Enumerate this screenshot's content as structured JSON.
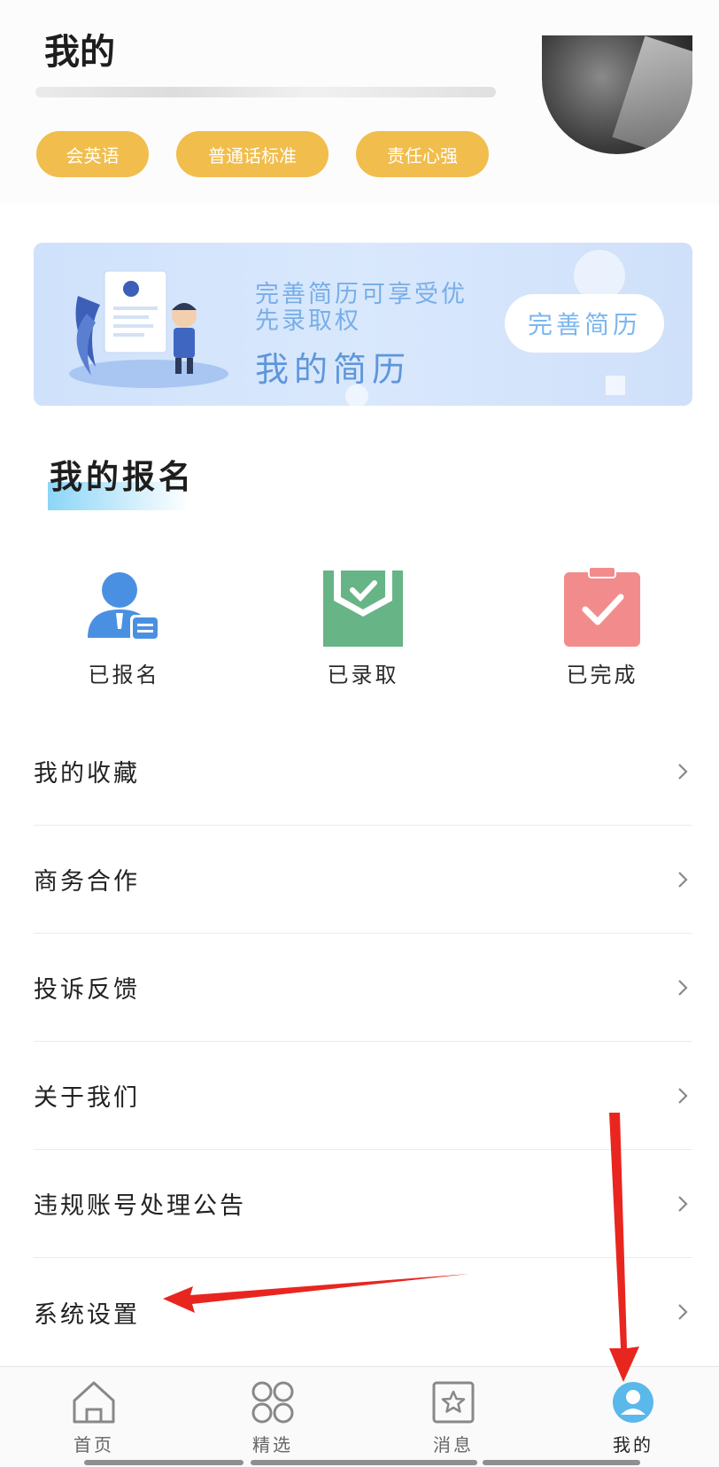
{
  "header": {
    "title": "我的",
    "tags": [
      "会英语",
      "普通话标准",
      "责任心强"
    ]
  },
  "resume_banner": {
    "line1": "完善简历可享受优",
    "line2": "先录取权",
    "title": "我的简历",
    "button_label": "完善简历"
  },
  "registration": {
    "title": "我的报名",
    "items": [
      {
        "label": "已报名",
        "icon": "person-card-icon",
        "color": "#4a90e2"
      },
      {
        "label": "已录取",
        "icon": "envelope-check-icon",
        "color": "#67b487"
      },
      {
        "label": "已完成",
        "icon": "clipboard-check-icon",
        "color": "#f28c8c"
      }
    ]
  },
  "menu": {
    "items": [
      {
        "label": "我的收藏"
      },
      {
        "label": "商务合作"
      },
      {
        "label": "投诉反馈"
      },
      {
        "label": "关于我们"
      },
      {
        "label": "违规账号处理公告"
      },
      {
        "label": "系统设置"
      }
    ]
  },
  "bottom_nav": {
    "items": [
      {
        "label": "首页",
        "icon": "home-icon"
      },
      {
        "label": "精选",
        "icon": "grid-icon"
      },
      {
        "label": "消息",
        "icon": "star-message-icon"
      },
      {
        "label": "我的",
        "icon": "profile-icon",
        "active": true
      }
    ]
  },
  "colors": {
    "tag": "#f1bd4c",
    "banner": "#d5e6fb",
    "arrow": "#e8261f"
  }
}
